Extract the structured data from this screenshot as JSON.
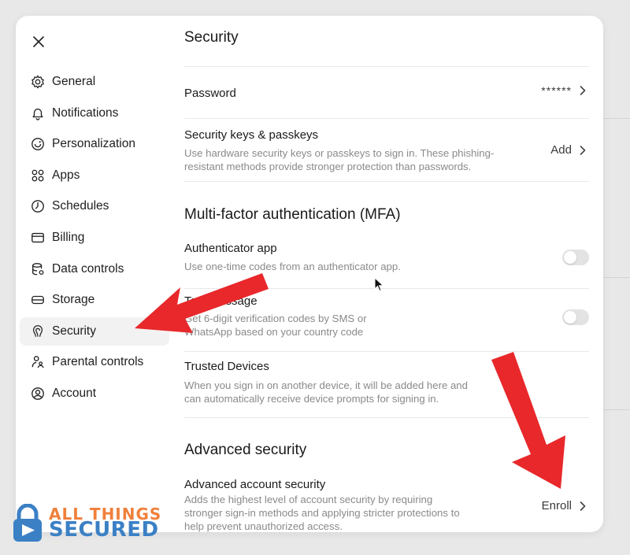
{
  "sidebar": {
    "close_icon": "close-icon",
    "items": [
      {
        "label": "General",
        "icon": "gear-icon"
      },
      {
        "label": "Notifications",
        "icon": "bell-icon"
      },
      {
        "label": "Personalization",
        "icon": "personalization-icon"
      },
      {
        "label": "Apps",
        "icon": "apps-grid-icon"
      },
      {
        "label": "Schedules",
        "icon": "clock-icon"
      },
      {
        "label": "Billing",
        "icon": "credit-card-icon"
      },
      {
        "label": "Data controls",
        "icon": "database-icon"
      },
      {
        "label": "Storage",
        "icon": "storage-icon"
      },
      {
        "label": "Security",
        "icon": "security-icon",
        "active": true
      },
      {
        "label": "Parental controls",
        "icon": "parental-icon"
      },
      {
        "label": "Account",
        "icon": "account-icon"
      }
    ]
  },
  "security": {
    "title": "Security",
    "password": {
      "title": "Password",
      "value": "******"
    },
    "keys": {
      "title": "Security keys & passkeys",
      "desc": "Use hardware security keys or passkeys to sign in. These phishing-resistant methods provide stronger protection than passwords.",
      "action": "Add"
    }
  },
  "mfa": {
    "title": "Multi-factor authentication (MFA)",
    "auth_app": {
      "title": "Authenticator app",
      "desc": "Use one-time codes from an authenticator app.",
      "enabled": false
    },
    "text_message": {
      "title": "Text message",
      "desc": "Get 6-digit verification codes by SMS or WhatsApp based on your country code",
      "enabled": false
    },
    "trusted": {
      "title": "Trusted Devices",
      "desc": "When you sign in on another device, it will be added here and can automatically receive device prompts for signing in."
    }
  },
  "advanced": {
    "title": "Advanced security",
    "account": {
      "title": "Advanced account security",
      "desc": "Adds the highest level of account security by requiring stronger sign-in methods and applying stricter protections to help prevent unauthorized access.",
      "action": "Enroll"
    }
  },
  "watermark": {
    "line1": "ALL THINGS",
    "line2": "SECURED"
  },
  "colors": {
    "arrow": "#e8282b",
    "watermark_orange": "#f0803c",
    "watermark_blue": "#3b80c5"
  }
}
